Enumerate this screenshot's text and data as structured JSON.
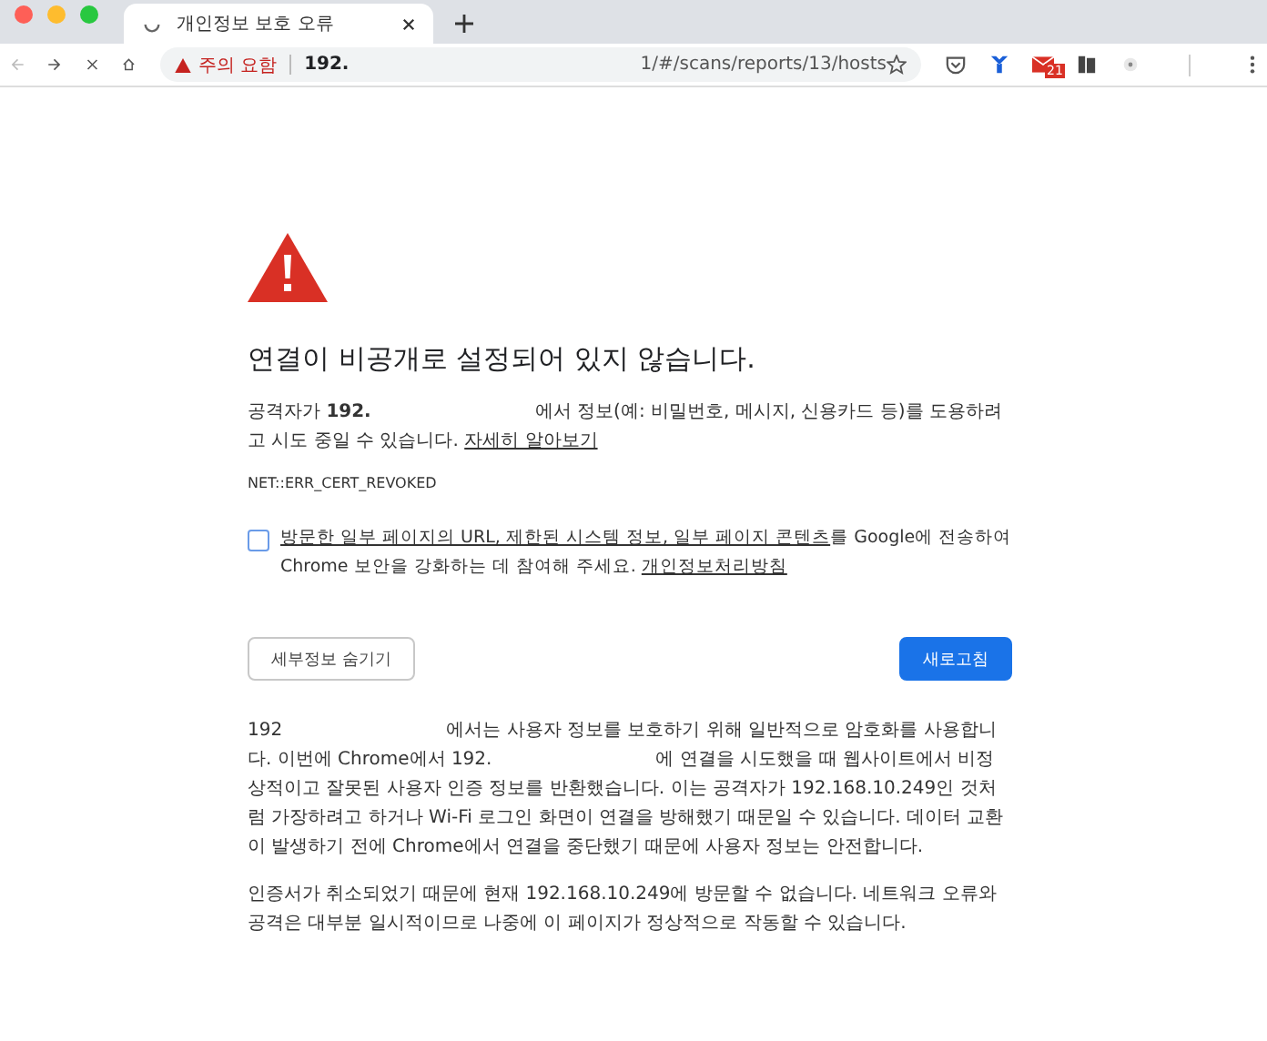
{
  "tab": {
    "title": "개인정보 보호 오류",
    "loading": true
  },
  "address_bar": {
    "warning": "주의 요함",
    "url_start": "192.",
    "url_end": "1/#/scans/reports/13/hosts",
    "bookmarked": false
  },
  "extensions": [
    {
      "kind": "pocket"
    },
    {
      "kind": "v"
    },
    {
      "kind": "mail",
      "badge": "21"
    },
    {
      "kind": "book"
    },
    {
      "kind": "dot"
    }
  ],
  "heading": "연결이 비공개로 설정되어 있지 않습니다.",
  "intro": {
    "parts": [
      "공격자가 **192.**",
      "에서 정보(예: 비밀번호, 메시지, 신용카드 등)를 도용하려고 시도 중일 수 있습니다."
    ],
    "link": "자세히 알아보기"
  },
  "error_code": "NET::ERR_CERT_REVOKED",
  "opt_in": {
    "checked": false,
    "link": "방문한 일부 페이지의 URL, 제한된 시스템 정보, 일부 페이지 콘텐츠",
    "text": "를 Google에 전송하여 Chrome 보안을 강화하는 데 참여해 주세요.",
    "policy_link": "개인정보처리방침"
  },
  "buttons": [
    {
      "label": "세부정보 숨기기",
      "kind": "secondary"
    },
    {
      "label": "새로고침",
      "kind": "primary"
    }
  ],
  "details": [
    {
      "parts": [
        "192",
        "에서는 사용자 정보를 보호하기 위해 일반적으로 암호화를 사용합니다. 이번에 Chrome에서 192.",
        "에 연결을 시도했을 때 웹사이트에서 비정상적이고 잘못된 사용자 인증 정보를 반환했습니다. 이는 공격자가 192.168.10.249인 것처럼 가장하려고 하거나 Wi-Fi 로그인 화면이 연결을 방해했기 때문일 수 있습니다. 데이터 교환이 발생하기 전에 Chrome에서 연결을 중단했기 때문에 사용자 정보는 안전합니다."
      ]
    },
    {
      "parts": [
        "인증서가 취소되었기 때문에 현재 192.168.10.249에 방문할 수 없습니다. 네트워크 오류와 공격은 대부분 일시적이므로 나중에 이 페이지가 정상적으로 작동할 수 있습니다."
      ]
    }
  ]
}
